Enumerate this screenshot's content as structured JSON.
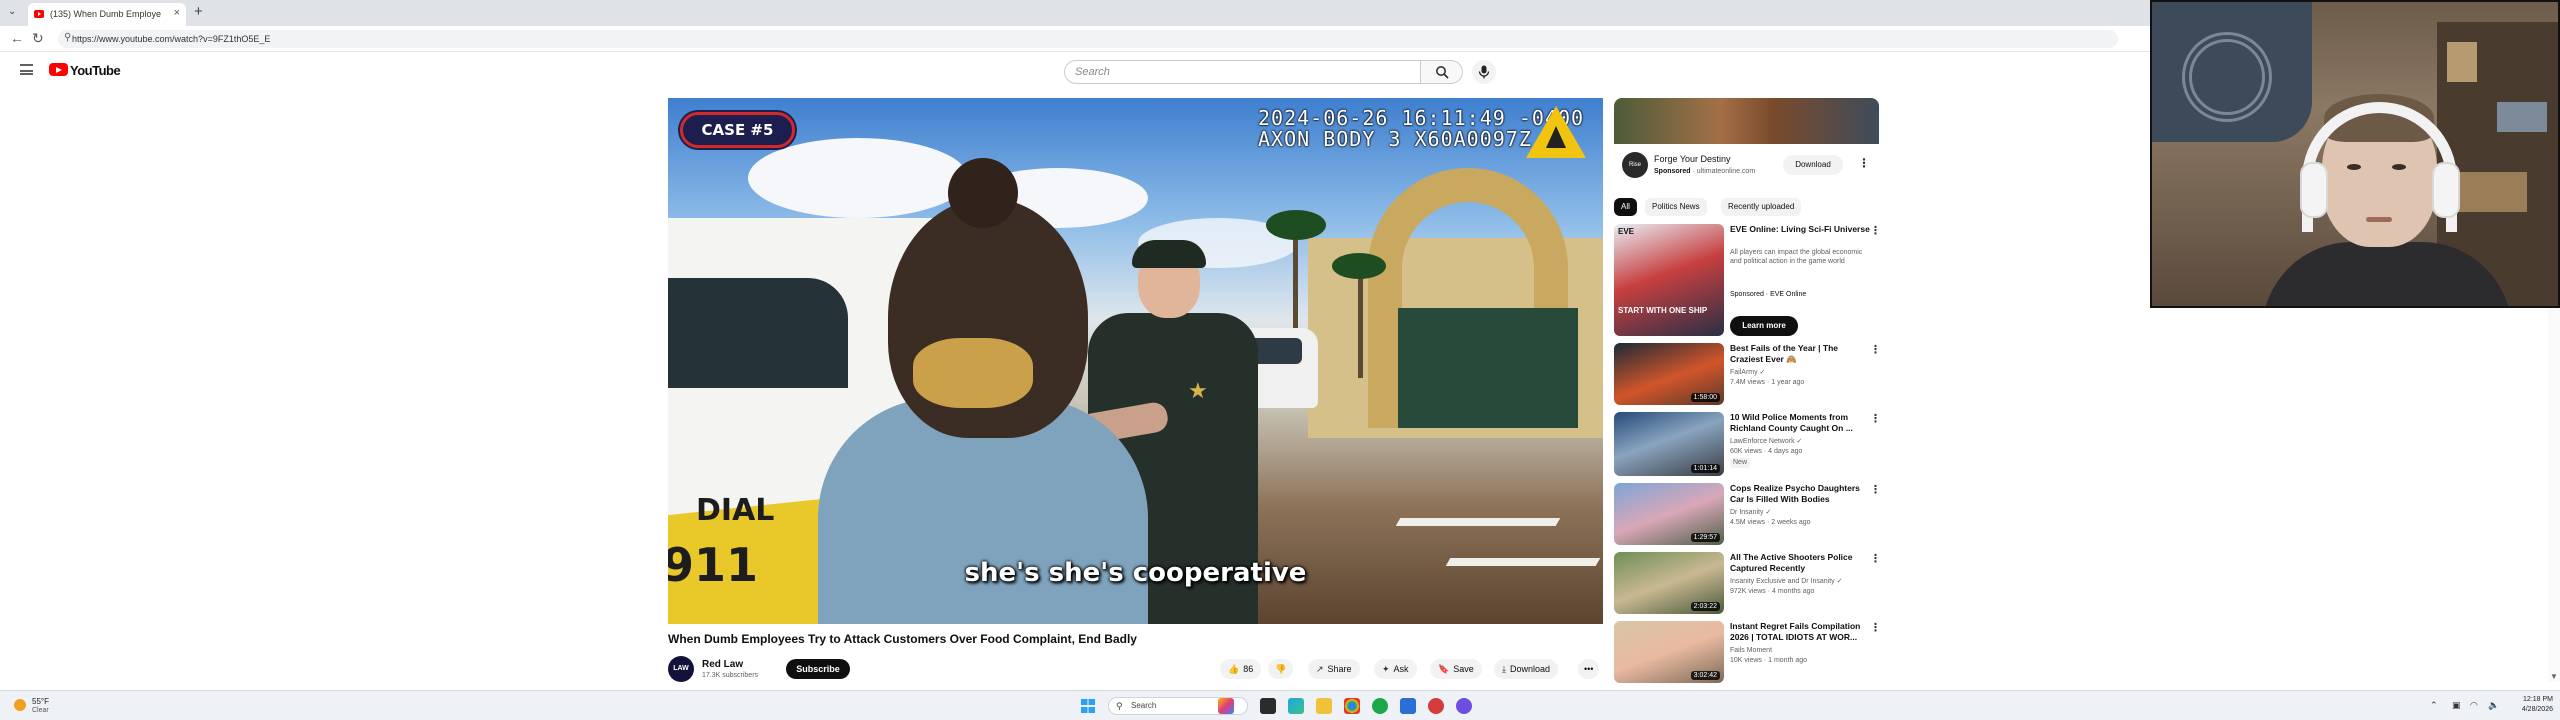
{
  "browser": {
    "tab_title": "(135) When Dumb Employe",
    "url": "https://www.youtube.com/watch?v=9FZ1thO5E_E",
    "new_tab_label": "+",
    "tab_close_label": "×"
  },
  "header": {
    "logo_text": "YouTube",
    "search_placeholder": "Search"
  },
  "video": {
    "case_badge": "CASE #5",
    "timestamp_line1": "2024-06-26 16:11:49 -0400",
    "timestamp_line2": "AXON BODY 3 X60A0097Z",
    "car_text_1": "DIAL",
    "car_text_2": "911",
    "subtitle": "she's she's cooperative",
    "title": "When Dumb Employees Try to Attack Customers Over Food Complaint, End Badly",
    "channel_avatar_text": "LAW",
    "channel_name": "Red Law",
    "subscriber_count": "17.3K subscribers",
    "subscribe_label": "Subscribe",
    "actions": {
      "like_count": "86",
      "share": "Share",
      "ask": "Ask",
      "save": "Save",
      "download": "Download",
      "more": "•••"
    }
  },
  "sidebar": {
    "ad": {
      "title": "Forge Your Destiny",
      "sponsored": "Sponsored",
      "domain": "ultimateonline.com",
      "download_label": "Download",
      "logo_text": "Rise"
    },
    "chips": [
      "All",
      "Politics News",
      "Recently uploaded"
    ],
    "recommendations": [
      {
        "title": "EVE Online: Living Sci-Fi Universe",
        "desc": "All players can impact the global economic and political action in the game world",
        "meta1": "Sponsored · EVE Online",
        "meta2": "",
        "cta": "Learn more",
        "duration": "",
        "thumb_text": "START WITH ONE SHIP",
        "thumb_brand": "EVE"
      },
      {
        "title": "Best Fails of the Year | The Craziest Ever 🙈",
        "meta1": "FailArmy ✓",
        "meta2": "7.4M views · 1 year ago",
        "duration": "1:58:00"
      },
      {
        "title": "10 Wild Police Moments from Richland County Caught On ...",
        "meta1": "LawEnforce Network ✓",
        "meta2": "60K views · 4 days ago",
        "badge": "New",
        "duration": "1:01:14"
      },
      {
        "title": "Cops Realize Psycho Daughters Car Is Filled With Bodies",
        "meta1": "Dr Insanity ✓",
        "meta2": "4.5M views · 2 weeks ago",
        "duration": "1:29:57"
      },
      {
        "title": "All The Active Shooters Police Captured Recently",
        "meta1": "Insanity Exclusive and Dr Insanity ✓",
        "meta2": "972K views · 4 months ago",
        "duration": "2:03:22"
      },
      {
        "title": "Instant Regret Fails Compilation 2026 | TOTAL IDIOTS AT WOR...",
        "meta1": "Fails Moment",
        "meta2": "10K views · 1 month ago",
        "duration": "3:02:42"
      }
    ]
  },
  "taskbar": {
    "weather_temp": "55°F",
    "weather_cond": "Clear",
    "search_placeholder": "Search",
    "clock_time": "12:18 PM",
    "clock_date": "4/28/2026"
  },
  "colors": {
    "youtube_red": "#ff0000",
    "accent_dark": "#0f0f0f",
    "chip_bg": "#f2f2f2"
  }
}
